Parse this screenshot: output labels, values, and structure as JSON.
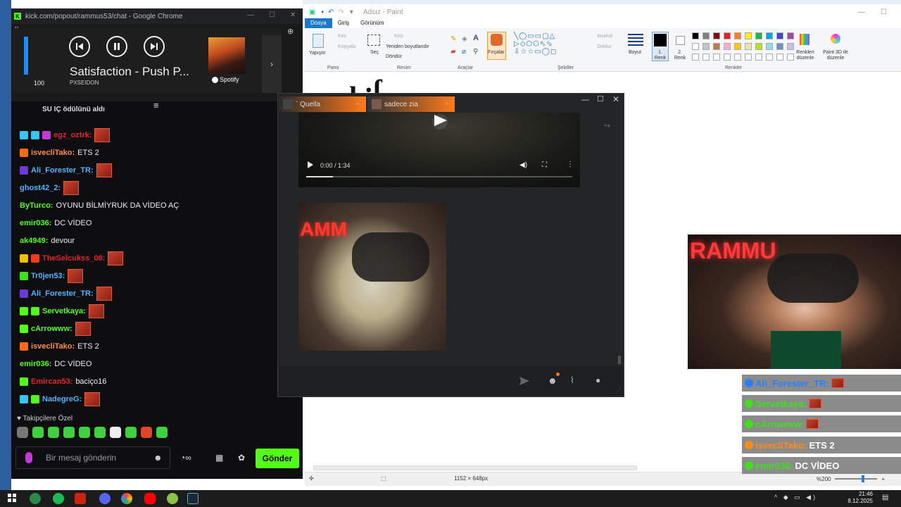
{
  "chrome": {
    "title": "kick.com/popout/rammus53/chat - Google Chrome"
  },
  "spotify": {
    "volume": "100",
    "volume_level": 1.0,
    "song": "Satisfaction - Push P...",
    "artist": "PXSEIDON",
    "brand": "Spotify"
  },
  "chat": {
    "gift_text": "SU IÇ ödülünü aldı",
    "messages": [
      {
        "user": "egz_oztrk:",
        "text": "",
        "color": "#e0242a",
        "emote": true
      },
      {
        "user": "isvecliTako:",
        "text": "ETS 2",
        "color": "#ff8c3c",
        "emote": false
      },
      {
        "user": "Ali_Forester_TR:",
        "text": "",
        "color": "#4fb3ff",
        "emote": true
      },
      {
        "user": "ghost42_2:",
        "text": "",
        "color": "#4fb3ff",
        "emote": true
      },
      {
        "user": "ByTurco:",
        "text": "OYUNU BİLMİYRUK DA VİDEO AÇ",
        "color": "#53fc18",
        "emote": false
      },
      {
        "user": "emir036:",
        "text": "DC VİDEO",
        "color": "#53fc18",
        "emote": false
      },
      {
        "user": "ak4949:",
        "text": "devour",
        "color": "#53fc18",
        "emote": false
      },
      {
        "user": "TheSelcukss_08:",
        "text": "",
        "color": "#e0242a",
        "emote": true
      },
      {
        "user": "Tr0jen53:",
        "text": "",
        "color": "#4fb3ff",
        "emote": true
      },
      {
        "user": "Ali_Forester_TR:",
        "text": "",
        "color": "#4fb3ff",
        "emote": true
      },
      {
        "user": "Servetkaya:",
        "text": "",
        "color": "#53fc18",
        "emote": true
      },
      {
        "user": "cArrowww:",
        "text": "",
        "color": "#53fc18",
        "emote": true
      },
      {
        "user": "isvecliTako:",
        "text": "ETS 2",
        "color": "#ff8c3c",
        "emote": false
      },
      {
        "user": "emir036:",
        "text": "DC VİDEO",
        "color": "#53fc18",
        "emote": false
      },
      {
        "user": "Emircan53:",
        "text": "baciço16",
        "color": "#e0242a",
        "emote": false
      },
      {
        "user": "NadegreG:",
        "text": "",
        "color": "#4fb3ff",
        "emote": true
      }
    ],
    "followers_label": "Takipçilere Özel",
    "input_placeholder": "Bir mesaj gönderin",
    "send_label": "Gönder"
  },
  "paint": {
    "title": "Adsız - Paint",
    "tabs": [
      "Dosya",
      "Giriş",
      "Görünüm"
    ],
    "groups": [
      "Pano",
      "Resim",
      "Araçlar",
      "Şekiller",
      "Renkler"
    ],
    "paste": "Yapıştır",
    "cut": "Kes",
    "copy": "Kopyala",
    "select": "Seç",
    "crop": "Kırp",
    "resize": "Yeniden boyutlandır",
    "rotate": "Döndür",
    "brushes": "Fırçalar",
    "outline": "Anahat",
    "fill": "Doldur",
    "size": "Boyut",
    "color1": "1. Renk",
    "color2": "2. Renk",
    "edit_colors": "Renkleri düzenle",
    "paint3d": "Paint 3D ile düzenle",
    "canvas_size": "1152 × 648px",
    "zoom": "%200",
    "palette": [
      "#000000",
      "#7f7f7f",
      "#880015",
      "#ed1c24",
      "#ff7f27",
      "#fff200",
      "#22b14c",
      "#00a2e8",
      "#3f48cc",
      "#a349a4",
      "#ffffff",
      "#c3c3c3",
      "#b97a57",
      "#ffaec9",
      "#ffc90e",
      "#efe4b0",
      "#b5e61d",
      "#99d9ea",
      "#7092be",
      "#c8bfe7"
    ]
  },
  "viewer": {
    "tabs": [
      {
        "label": "` Quella"
      },
      {
        "label": "sadece zia"
      }
    ],
    "video_time": "0:00 / 1:34",
    "video_progress": 0.1,
    "photo_text": "AMM"
  },
  "overlay": {
    "cam_text": "RAMMU",
    "messages": [
      {
        "user": "Ali_Forester_TR:",
        "text": "",
        "color": "#2a7fff",
        "emote": true
      },
      {
        "user": "Servetkaya:",
        "text": "",
        "color": "#3fe01a",
        "emote": true
      },
      {
        "user": "cArrowww:",
        "text": "",
        "color": "#3fe01a",
        "emote": true
      },
      {
        "user": "isvecliTako:",
        "text": "ETS 2",
        "color": "#ff8c1a",
        "emote": false
      },
      {
        "user": "emir036:",
        "text": "DC VİDEO",
        "color": "#3fe01a",
        "emote": false
      }
    ]
  },
  "taskbar": {
    "time": "21:46",
    "date": "8.12.2025"
  }
}
